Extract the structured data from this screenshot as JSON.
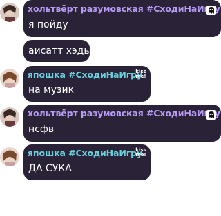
{
  "colors": {
    "bubble": "#2a2236",
    "name_purple": "#b99af5",
    "name_teal": "#69d2e0",
    "text": "#ffffff"
  },
  "messages": [
    {
      "user": "хольтвёрт разумовская #СходиНаИгру",
      "text": "я пойду",
      "badge_icon": "ghost-icon",
      "name_color": "purple"
    },
    {
      "user": "",
      "text": "аисатт хэды"
    },
    {
      "user": "япошка #СходиНаИгру",
      "text": "на музик",
      "badge": "kiss me!",
      "name_color": "teal"
    },
    {
      "user": "хольтвёрт разумовская #СходиНаИгру",
      "text": "нсфв",
      "badge_icon": "ghost-icon",
      "name_color": "purple"
    },
    {
      "user": "япошка #СходиНаИгру",
      "text": "ДА СУКА",
      "badge": "kiss me!",
      "name_color": "teal"
    }
  ]
}
